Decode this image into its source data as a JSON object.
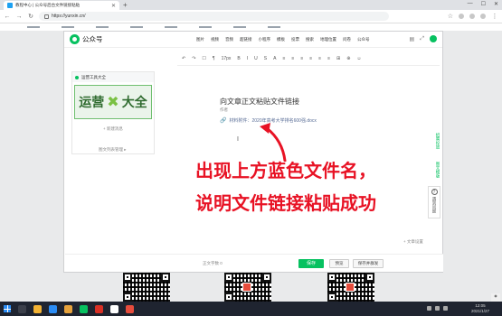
{
  "browser": {
    "tab_title": "教程中心 | 公众号后台文件链接粘贴",
    "new_tab": "+",
    "address": "https://yunxin.cn/",
    "win_min": "—",
    "win_max": "☐",
    "win_close": "✕"
  },
  "app": {
    "brand": "公众号",
    "menu": [
      "图片",
      "视频",
      "音频",
      "超链接",
      "小程序",
      "模板",
      "投票",
      "搜索",
      "地理位置",
      "问卷",
      "公众号"
    ],
    "toolbar": [
      "↶",
      "↷",
      "☐",
      "¶",
      "17px",
      "B",
      "I",
      "U",
      "S",
      "A",
      "≡",
      "≡",
      "≡",
      "≡",
      "≡",
      "≡",
      "⊞",
      "⊕",
      "☺"
    ],
    "left_panel": {
      "header": "运营工具大全",
      "thumb_text_left": "运营",
      "thumb_cross": "✖",
      "thumb_text_right": "大全",
      "add": "+ 新建消息",
      "footer": "图文列表管理 ▸"
    },
    "editor": {
      "title": "向文章正文粘贴文件链接",
      "author": "作者",
      "attachment": "材料附件：2020年高考大学排名600强.docx"
    },
    "right_links": [
      "招聘投放",
      "图文模版"
    ],
    "help_label": "遇到问题",
    "settings_link": "+ 文章设置",
    "wordcount": "正文字数 0",
    "buttons": {
      "save": "保存",
      "preview": "预览",
      "publish": "保存并群发"
    }
  },
  "overlay": {
    "line1": "出现上方蓝色文件名，",
    "line2": "说明文件链接粘贴成功"
  },
  "taskbar": {
    "time": "12:05",
    "date": "2021/1/27"
  },
  "colors": {
    "accent": "#07c160",
    "overlay_red": "#e81224",
    "link_blue": "#576b95"
  }
}
